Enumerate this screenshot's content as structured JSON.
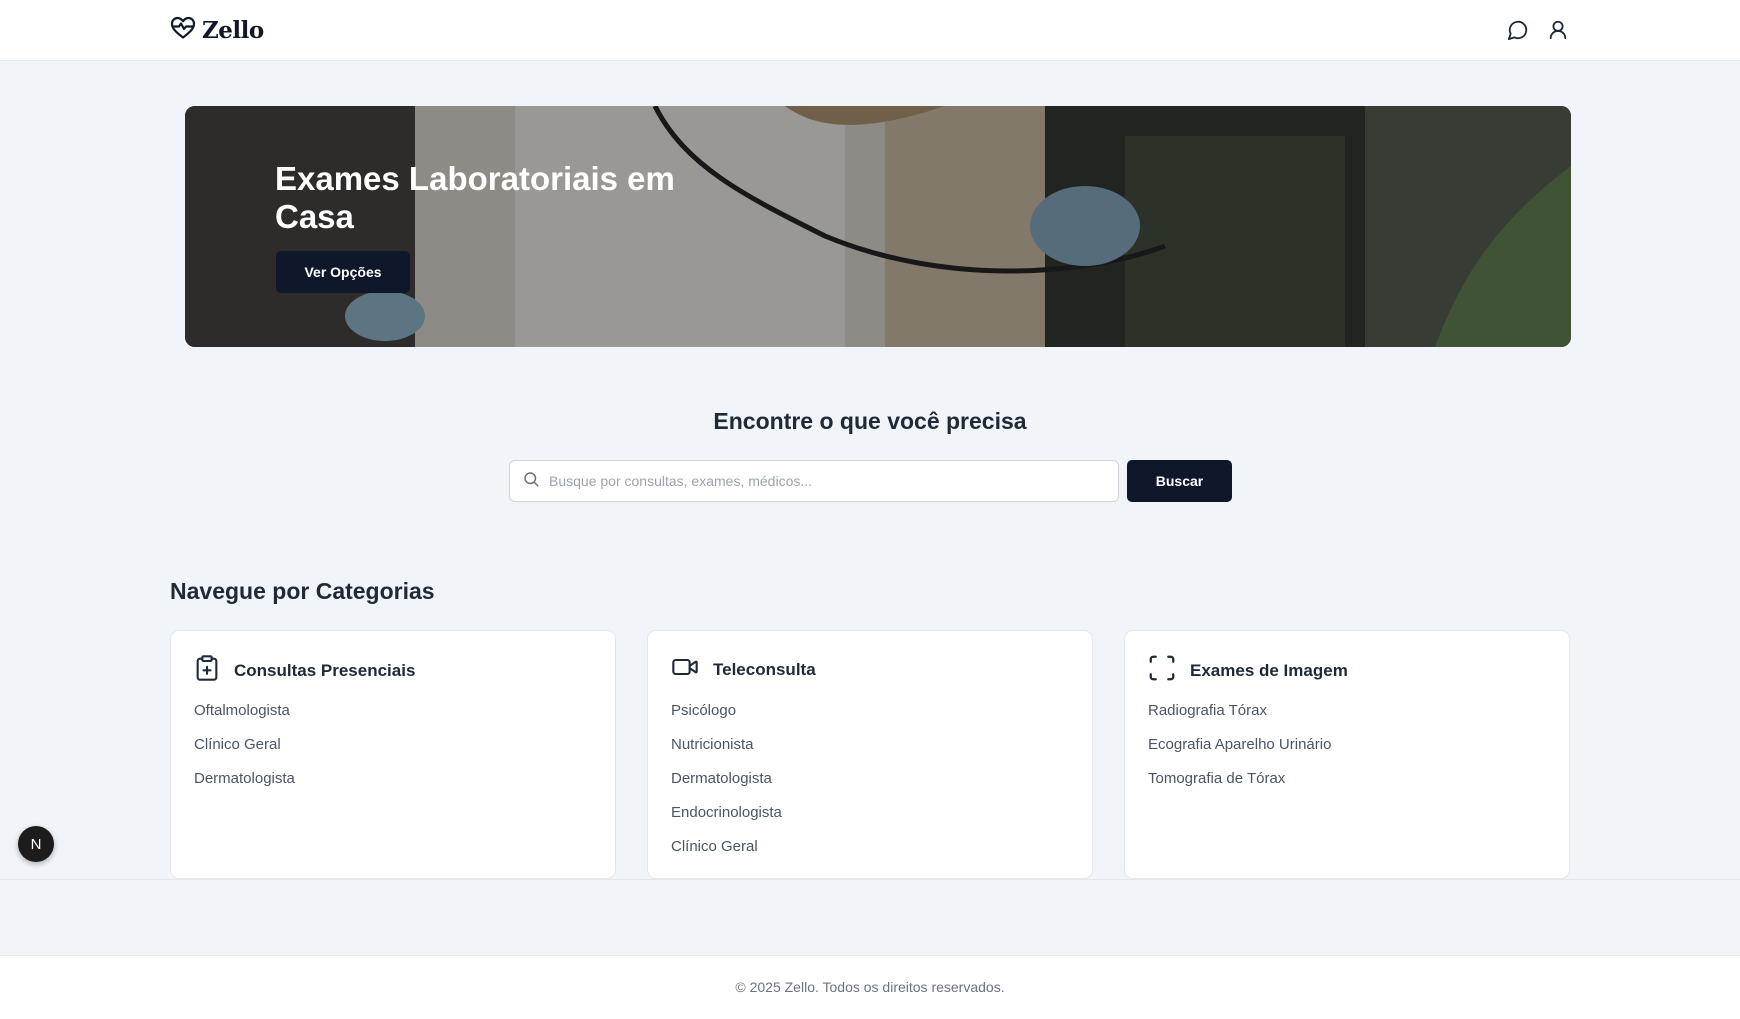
{
  "header": {
    "logo_text": "Zello",
    "icons": [
      "heart-pulse-icon",
      "chat-icon",
      "user-icon"
    ]
  },
  "hero": {
    "title": "Exames Laboratoriais em Casa",
    "button_label": "Ver Opções"
  },
  "search": {
    "title": "Encontre o que você precisa",
    "placeholder": "Busque por consultas, exames, médicos...",
    "button_label": "Buscar"
  },
  "categories": {
    "heading": "Navegue por Categorias",
    "cards": [
      {
        "title": "Consultas Presenciais",
        "icon": "clipboard-plus-icon",
        "items": [
          "Oftalmologista",
          "Clínico Geral",
          "Dermatologista"
        ]
      },
      {
        "title": "Teleconsulta",
        "icon": "video-icon",
        "items": [
          "Psicólogo",
          "Nutricionista",
          "Dermatologista",
          "Endocrinologista",
          "Clínico Geral"
        ]
      },
      {
        "title": "Exames de Imagem",
        "icon": "scan-icon",
        "items": [
          "Radiografia Tórax",
          "Ecografia Aparelho Urinário",
          "Tomografia de Tórax"
        ]
      }
    ]
  },
  "fab": {
    "label": "N"
  },
  "footer": {
    "text": "© 2025 Zello. Todos os direitos reservados."
  },
  "colors": {
    "primary": "#0f172a",
    "background": "#f1f4f8",
    "text": "#1f2937",
    "muted": "#4b5563"
  }
}
